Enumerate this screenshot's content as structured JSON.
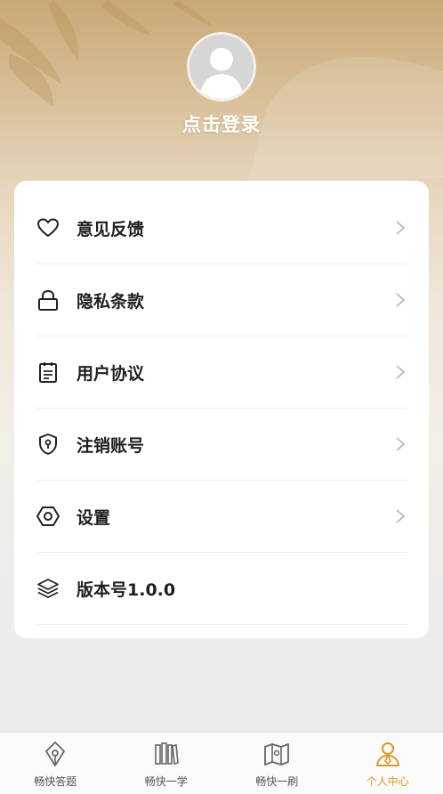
{
  "header": {
    "login_label": "点击登录"
  },
  "menu": {
    "items": [
      {
        "label": "意见反馈",
        "icon": "heart-icon"
      },
      {
        "label": "隐私条款",
        "icon": "lock-icon"
      },
      {
        "label": "用户协议",
        "icon": "document-icon"
      },
      {
        "label": "注销账号",
        "icon": "shield-icon"
      },
      {
        "label": "设置",
        "icon": "hexagon-settings-icon"
      },
      {
        "label": "版本号1.0.0",
        "icon": "layers-icon"
      }
    ]
  },
  "tabbar": {
    "tabs": [
      {
        "label": "畅快答题",
        "icon": "pen-nib-icon",
        "active": false
      },
      {
        "label": "畅快一学",
        "icon": "books-icon",
        "active": false
      },
      {
        "label": "畅快一刷",
        "icon": "map-icon",
        "active": false
      },
      {
        "label": "个人中心",
        "icon": "person-icon",
        "active": true
      }
    ]
  },
  "colors": {
    "accent": "#d89a2a",
    "header_gold": "#c9a877",
    "card": "#ffffff",
    "page_bg": "#ebebeb"
  }
}
